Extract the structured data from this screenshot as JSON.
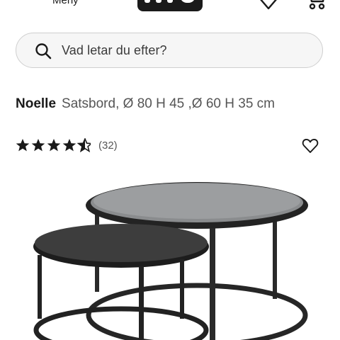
{
  "header": {
    "menu_label": "Meny",
    "logo_text": "mio",
    "icons": [
      "hamburger-icon",
      "heart-icon",
      "cart-icon"
    ]
  },
  "search": {
    "placeholder": "Vad letar du efter?"
  },
  "product": {
    "brand": "Noelle",
    "description": "Satsbord, Ø 80 H 45 ,Ø 60 H 35 cm",
    "rating": 4.5,
    "review_count": "(32)"
  },
  "colors": {
    "text": "#1a1a1a",
    "muted": "#555555",
    "search_bg": "#f6f6f6",
    "search_border": "#cfcfcf"
  }
}
